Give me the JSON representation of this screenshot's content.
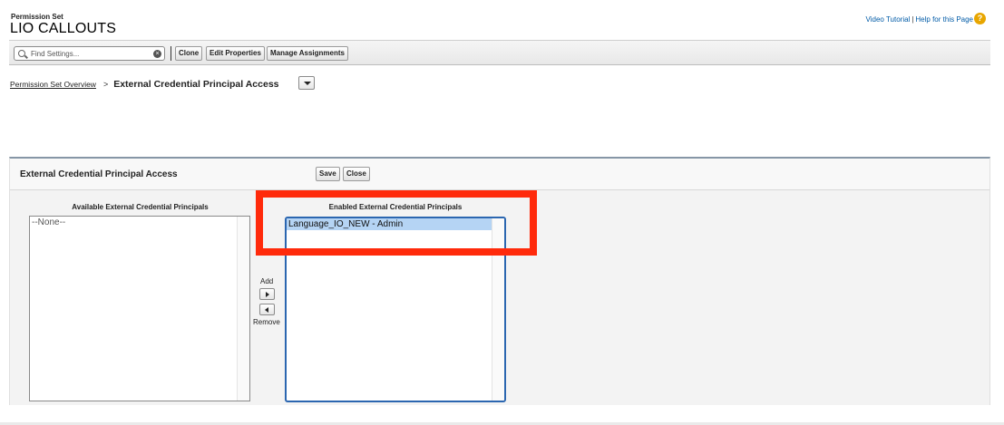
{
  "header": {
    "object_type": "Permission Set",
    "title": "LIO CALLOUTS",
    "video_tutorial": "Video Tutorial",
    "separator": "|",
    "help_link": "Help for this Page",
    "help_icon_glyph": "?"
  },
  "toolbar": {
    "search_placeholder": "Find Settings...",
    "clear_glyph": "×",
    "buttons": [
      "Clone",
      "Edit Properties",
      "Manage Assignments"
    ]
  },
  "breadcrumb": {
    "parent": "Permission Set Overview",
    "separator": ">",
    "current": "External Credential Principal Access"
  },
  "panel": {
    "title": "External Credential Principal Access",
    "save_label": "Save",
    "close_label": "Close",
    "available_label": "Available External Credential Principals",
    "available_options": [
      "--None--"
    ],
    "enabled_label": "Enabled External Credential Principals",
    "enabled_options": [
      "Language_IO_NEW - Admin"
    ],
    "add_label": "Add",
    "remove_label": "Remove"
  },
  "colors": {
    "highlight": "#ff2a0b",
    "link": "#015ba7",
    "selected_option": "#b5d4f4",
    "panel_border": "#8696a6"
  }
}
